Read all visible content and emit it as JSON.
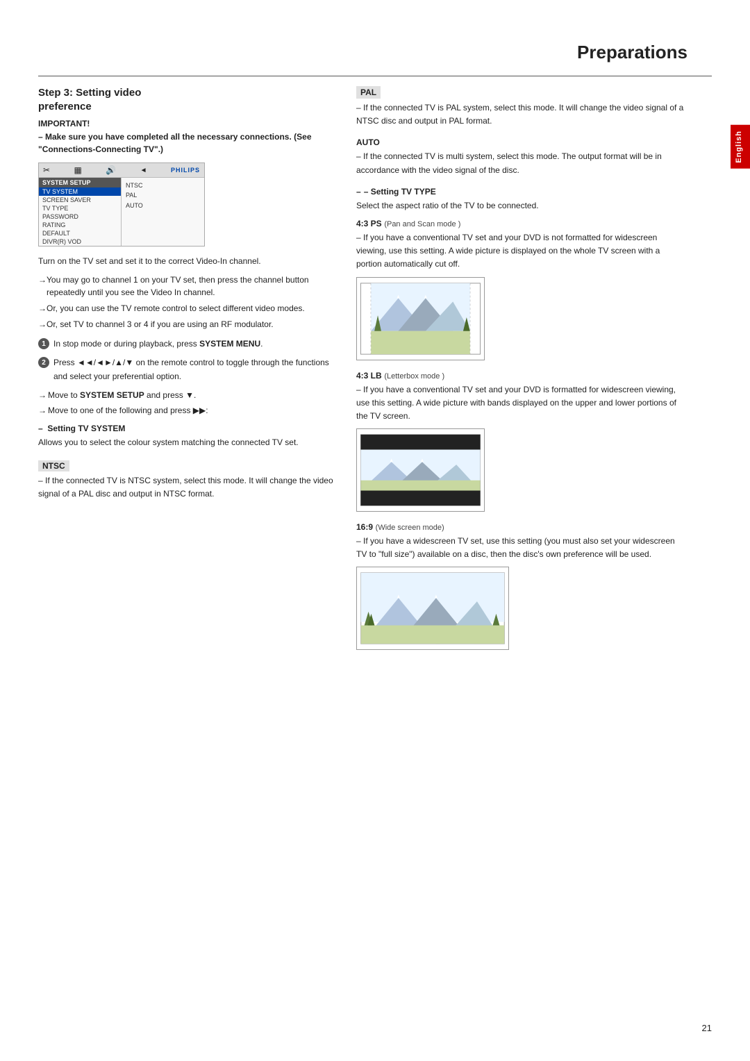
{
  "page": {
    "title": "Preparations",
    "number": "21",
    "side_tab": "English"
  },
  "step": {
    "heading_line1": "Step 3:  Setting video",
    "heading_line2": "preference"
  },
  "important": {
    "label": "IMPORTANT!",
    "lines": [
      "– Make sure you have completed all the",
      "necessary connections. (See",
      "\"Connections-Connecting TV\".)"
    ]
  },
  "screen": {
    "title": "SYSTEM SETUP",
    "menu_items": [
      "TV SYSTEM",
      "SCREEN SAVER",
      "TV TYPE",
      "PASSWORD",
      "RATING",
      "DEFAULT",
      "DIVR(R) VOD"
    ],
    "values": [
      "NTSC",
      "PAL",
      "AUTO"
    ]
  },
  "body_paragraphs": [
    "Turn on the TV set and set it to the correct Video-In channel.",
    "You may go to channel 1 on your TV set, then press the channel button repeatedly until you see the Video In channel.",
    "Or, you can use the TV remote control to select different video modes.",
    "Or, set TV to channel 3 or 4 if you are using an RF modulator."
  ],
  "numbered_items": [
    {
      "number": "1",
      "text": "In stop mode or during playback, press ",
      "bold": "SYSTEM MENU",
      "tail": "."
    },
    {
      "number": "2",
      "text_prefix": "Press ◄◄/◄►/▲/▼ on the remote control to toggle through the functions and select your preferential option."
    }
  ],
  "sub_arrows": [
    "Move to SYSTEM SETUP and press ▼.",
    "Move to one of the following and press ▶▶:"
  ],
  "setting_tv_system": {
    "dash_label": "– Setting TV SYSTEM",
    "body": "Allows you to select the colour system matching the connected TV set."
  },
  "ntsc": {
    "label": "NTSC",
    "text": "– If the connected TV is NTSC system, select this mode. It will change the video signal of a PAL disc and output in NTSC format."
  },
  "pal": {
    "label": "PAL",
    "text": "– If the connected TV is PAL system, select this mode. It will change the video signal of a NTSC disc and output in PAL format."
  },
  "auto": {
    "label": "AUTO",
    "text": "– If the connected TV is multi system, select this mode. The output format will be in accordance with the video signal of the disc."
  },
  "setting_tv_type": {
    "dash_label": "– Setting TV TYPE",
    "intro": "Select the aspect ratio of the TV to be connected."
  },
  "ps43": {
    "label": "4:3 PS",
    "sublabel": "(Pan and Scan mode )",
    "text": "– If you have a conventional TV set and your DVD is not formatted for widescreen viewing, use this setting. A wide picture is displayed on the whole TV screen with a portion automatically cut off."
  },
  "lb43": {
    "label": "4:3 LB",
    "sublabel": "(Letterbox mode )",
    "text": "– If you have a conventional TV set and your DVD is formatted for widescreen viewing, use this setting. A wide picture with bands displayed on the upper and lower portions of the TV screen."
  },
  "wide169": {
    "label": "16:9",
    "sublabel": "(Wide screen mode)",
    "text": "– If you have a widescreen TV set, use this setting (you must also set your widescreen TV to \"full size\") available on a disc, then the disc's own preference will be used."
  }
}
